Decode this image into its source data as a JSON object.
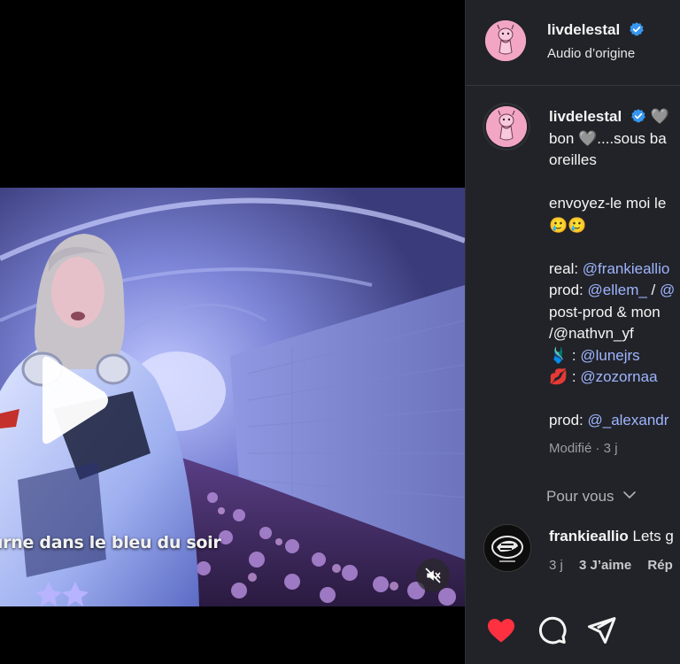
{
  "video": {
    "subtitle": "urne dans le bleu du soir",
    "play_icon": "play-icon",
    "mute_icon": "speaker-muted-icon"
  },
  "header": {
    "username": "livdelestal",
    "audio": "Audio d’origine",
    "verified_icon": "verified-badge-icon"
  },
  "caption": {
    "username": "livdelestal",
    "emoji_after_name": "🩶",
    "lines": [
      {
        "text": "bon 🩶....sous ba",
        "mention": ""
      },
      {
        "text": "oreilles",
        "mention": ""
      },
      {
        "text": "",
        "mention": ""
      },
      {
        "text": "envoyez-le moi le",
        "mention": ""
      },
      {
        "text": "🥲🥲",
        "mention": ""
      },
      {
        "text": "",
        "mention": ""
      },
      {
        "text": "real: ",
        "mention": "@frankieallio"
      },
      {
        "text": "prod: ",
        "mention": "@ellem_",
        "after": " / ",
        "mention2": "@"
      },
      {
        "text": "post-prod & mon",
        "mention": ""
      },
      {
        "text": "/@nathvn_yf",
        "mention": ""
      },
      {
        "text": "🩱 : ",
        "mention": "@lunejrs"
      },
      {
        "text": "💋 : ",
        "mention": "@zozornaa"
      },
      {
        "text": "",
        "mention": ""
      },
      {
        "text": "prod: ",
        "mention": "@_alexandr"
      }
    ],
    "meta": "Modifié · 3 j"
  },
  "for_you": {
    "label": "Pour vous",
    "icon": "chevron-down-icon"
  },
  "comment": {
    "username": "frankieallio",
    "text": "Lets g",
    "age": "3 j",
    "likes": "3 J’aime",
    "reply": "Rép"
  },
  "actions": {
    "like_icon": "heart-filled-icon",
    "comment_icon": "comment-bubble-icon",
    "share_icon": "paper-plane-icon",
    "like_color": "#ff3040"
  },
  "colors": {
    "panel_bg": "#212328",
    "mention": "#9fb4ff",
    "verified": "#3797f0"
  }
}
